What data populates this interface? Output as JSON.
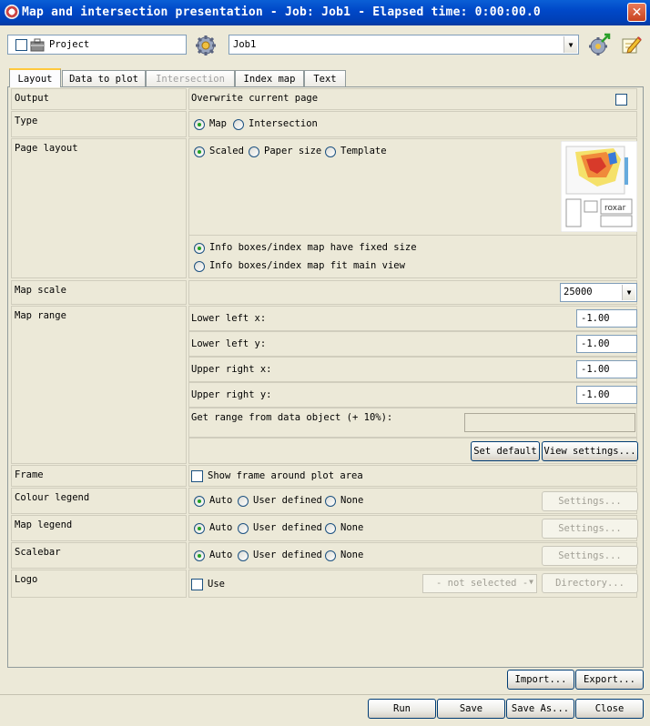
{
  "window": {
    "title": "Map and intersection presentation - Job: Job1 - Elapsed time: 0:00:00.0",
    "close_glyph": "✕"
  },
  "toolbar": {
    "project_label": "Project",
    "job_value": "Job1"
  },
  "tabs": [
    {
      "label": "Layout",
      "state": "active"
    },
    {
      "label": "Data to plot",
      "state": "normal"
    },
    {
      "label": "Intersection",
      "state": "disabled"
    },
    {
      "label": "Index map",
      "state": "normal"
    },
    {
      "label": "Text",
      "state": "normal"
    }
  ],
  "layout": {
    "output": {
      "label": "Output",
      "text": "Overwrite current page",
      "checked": false
    },
    "type": {
      "label": "Type",
      "options": [
        "Map",
        "Intersection"
      ],
      "selected": "Map"
    },
    "page_layout": {
      "label": "Page layout",
      "options": [
        "Scaled",
        "Paper size",
        "Template"
      ],
      "selected": "Scaled",
      "size_options": [
        "Info boxes/index map have fixed size",
        "Info boxes/index map fit main view"
      ],
      "size_selected": "Info boxes/index map have fixed size"
    },
    "map_scale": {
      "label": "Map scale",
      "value": "25000"
    },
    "map_range": {
      "label": "Map range",
      "lower_left_x_label": "Lower left x:",
      "lower_left_x": "-1.00",
      "lower_left_y_label": "Lower left y:",
      "lower_left_y": "-1.00",
      "upper_right_x_label": "Upper right x:",
      "upper_right_x": "-1.00",
      "upper_right_y_label": "Upper right y:",
      "upper_right_y": "-1.00",
      "get_range_label": "Get range from data object (+ 10%):",
      "set_default": "Set default",
      "view_settings": "View settings..."
    },
    "frame": {
      "label": "Frame",
      "text": "Show frame around plot area",
      "checked": false
    },
    "colour_legend": {
      "label": "Colour legend",
      "options": [
        "Auto",
        "User defined",
        "None"
      ],
      "selected": "Auto",
      "settings": "Settings..."
    },
    "map_legend": {
      "label": "Map legend",
      "options": [
        "Auto",
        "User defined",
        "None"
      ],
      "selected": "Auto",
      "settings": "Settings..."
    },
    "scalebar": {
      "label": "Scalebar",
      "options": [
        "Auto",
        "User defined",
        "None"
      ],
      "selected": "Auto",
      "settings": "Settings..."
    },
    "logo": {
      "label": "Logo",
      "use": "Use",
      "checked": false,
      "selection": "- not selected -",
      "directory": "Directory..."
    }
  },
  "footer": {
    "import": "Import...",
    "export": "Export...",
    "run": "Run",
    "save": "Save",
    "save_as": "Save As...",
    "close": "Close"
  },
  "colors": {
    "title_bar": "#0048c8",
    "window_bg": "#ece9d8",
    "tab_highlight": "#ffc83c"
  }
}
